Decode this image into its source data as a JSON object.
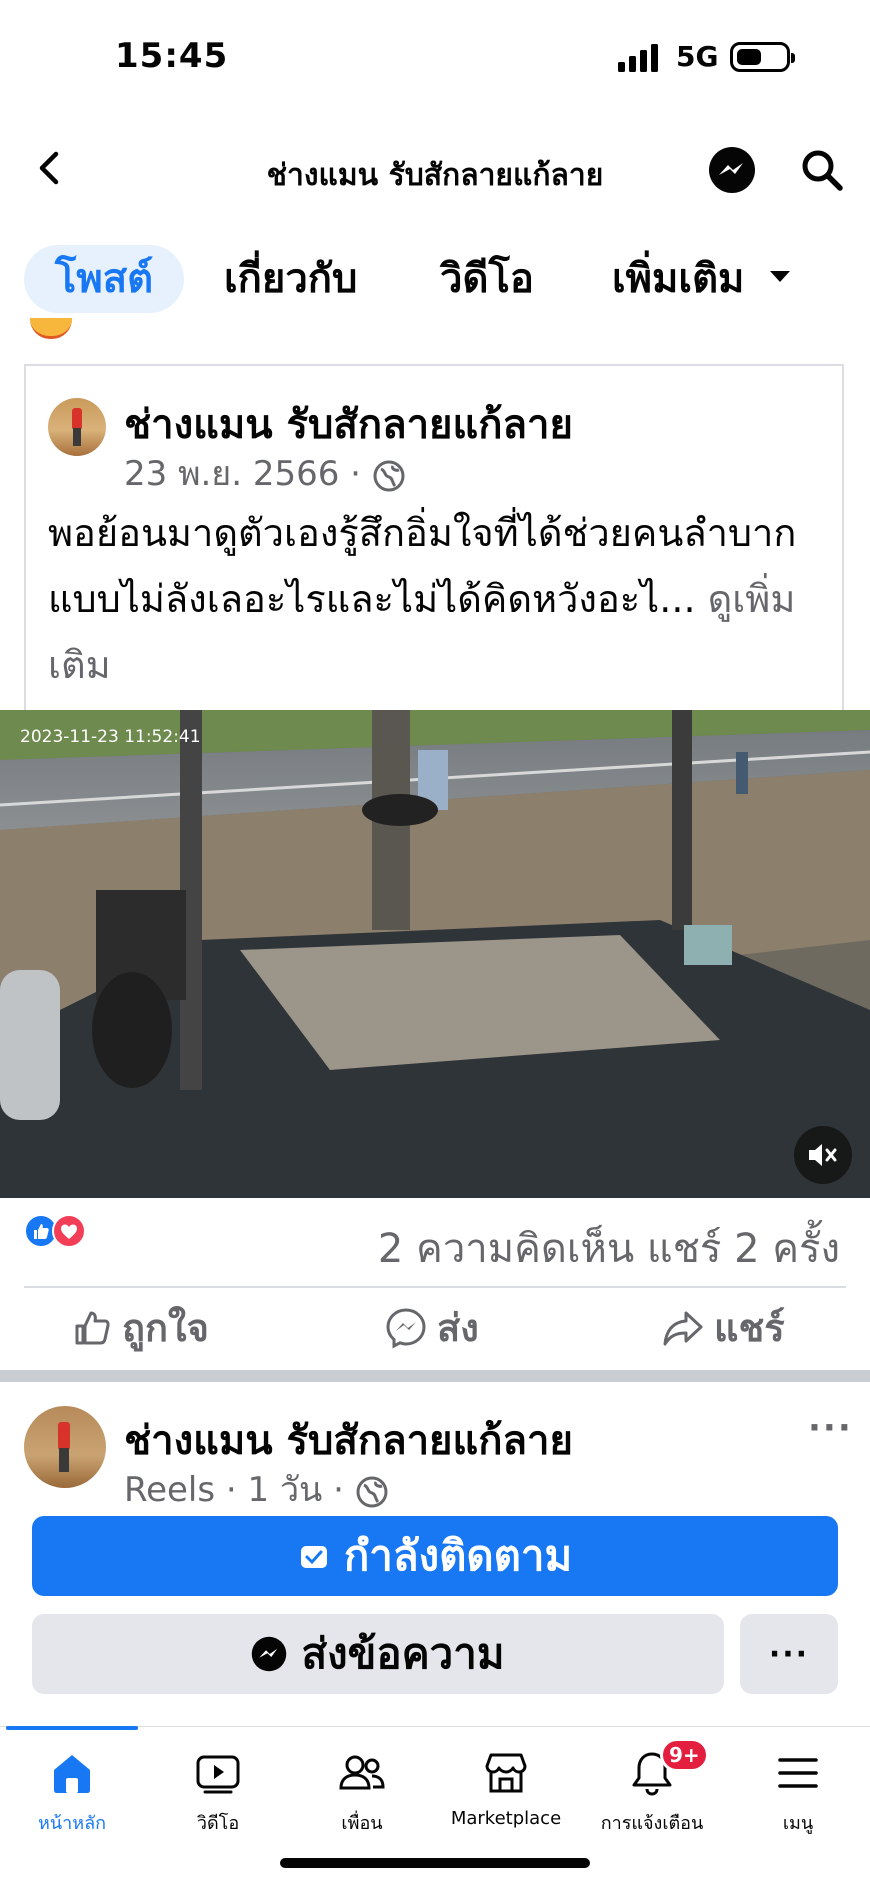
{
  "status_bar": {
    "time": "15:45",
    "network": "5G"
  },
  "header": {
    "title": "ช่างแมน รับสักลายแก้ลาย"
  },
  "tabs": [
    {
      "label": "โพสต์"
    },
    {
      "label": "เกี่ยวกับ"
    },
    {
      "label": "วิดีโอ"
    },
    {
      "label": "เพิ่มเติม"
    }
  ],
  "post1": {
    "page_name": "ช่างแมน รับสักลายแก้ลาย",
    "date": "23 พ.ย. 2566 ·",
    "text": "พอย้อนมาดูตัวเองรู้สึกอิ่มใจที่ได้ช่วยคนลำบากแบบไม่ลังเลอะไรและไม่ได้คิดหวังอะไ...",
    "see_more": "ดูเพิ่มเติม",
    "video_timestamp": "2023-11-23  11:52:41",
    "counts": "2 ความคิดเห็น  แชร์ 2 ครั้ง",
    "actions": {
      "like": "ถูกใจ",
      "send": "ส่ง",
      "share": "แชร์"
    }
  },
  "post2": {
    "page_name": "ช่างแมน รับสักลายแก้ลาย",
    "meta": "Reels · 1 วัน ·",
    "follow_label": "กำลังติดตาม",
    "message_label": "ส่งข้อความ",
    "more_label": "···"
  },
  "bottom_nav": {
    "home": "หน้าหลัก",
    "video": "วิดีโอ",
    "friends": "เพื่อน",
    "marketplace": "Marketplace",
    "notifications": "การแจ้งเตือน",
    "menu": "เมนู",
    "notification_badge": "9+"
  },
  "colors": {
    "accent": "#1877f2",
    "badge": "#e41e3f",
    "secondary_text": "#65676b"
  }
}
